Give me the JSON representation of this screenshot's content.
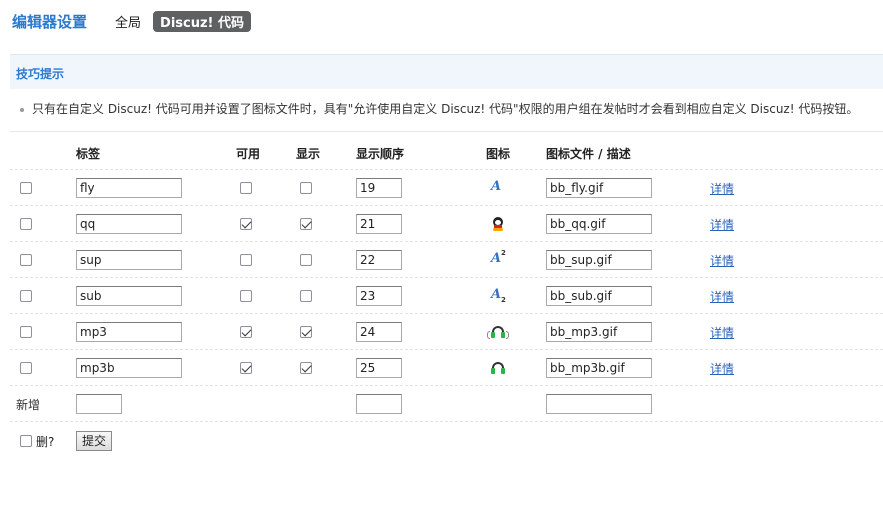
{
  "topnav": {
    "title": "编辑器设置",
    "tabs": [
      {
        "label": "全局",
        "active": false
      },
      {
        "label": "Discuz! 代码",
        "active": true
      }
    ]
  },
  "tips": {
    "heading": "技巧提示",
    "text": "只有在自定义 Discuz! 代码可用并设置了图标文件时，具有\"允许使用自定义 Discuz! 代码\"权限的用户组在发帖时才会看到相应自定义 Discuz! 代码按钮。"
  },
  "headers": {
    "tag": "标签",
    "available": "可用",
    "display": "显示",
    "order": "显示顺序",
    "icon": "图标",
    "file": "图标文件 / 描述"
  },
  "rows": [
    {
      "tag": "fly",
      "available": false,
      "display": false,
      "order": "19",
      "icon": "fly-icon",
      "file": "bb_fly.gif",
      "detail": "详情"
    },
    {
      "tag": "qq",
      "available": true,
      "display": true,
      "order": "21",
      "icon": "qq-icon",
      "file": "bb_qq.gif",
      "detail": "详情"
    },
    {
      "tag": "sup",
      "available": false,
      "display": false,
      "order": "22",
      "icon": "sup-icon",
      "file": "bb_sup.gif",
      "detail": "详情"
    },
    {
      "tag": "sub",
      "available": false,
      "display": false,
      "order": "23",
      "icon": "sub-icon",
      "file": "bb_sub.gif",
      "detail": "详情"
    },
    {
      "tag": "mp3",
      "available": true,
      "display": true,
      "order": "24",
      "icon": "mp3-icon",
      "file": "bb_mp3.gif",
      "detail": "详情"
    },
    {
      "tag": "mp3b",
      "available": true,
      "display": true,
      "order": "25",
      "icon": "mp3b-icon",
      "file": "bb_mp3b.gif",
      "detail": "详情"
    }
  ],
  "new_row": {
    "label": "新增",
    "tag": "",
    "order": "",
    "file": ""
  },
  "footer": {
    "delete_label": "删?",
    "submit_label": "提交"
  },
  "colors": {
    "accent": "#2b7acd",
    "active_tab_bg": "#5e6062",
    "tips_bg": "#f0f6fc",
    "link": "#2b64b5"
  }
}
